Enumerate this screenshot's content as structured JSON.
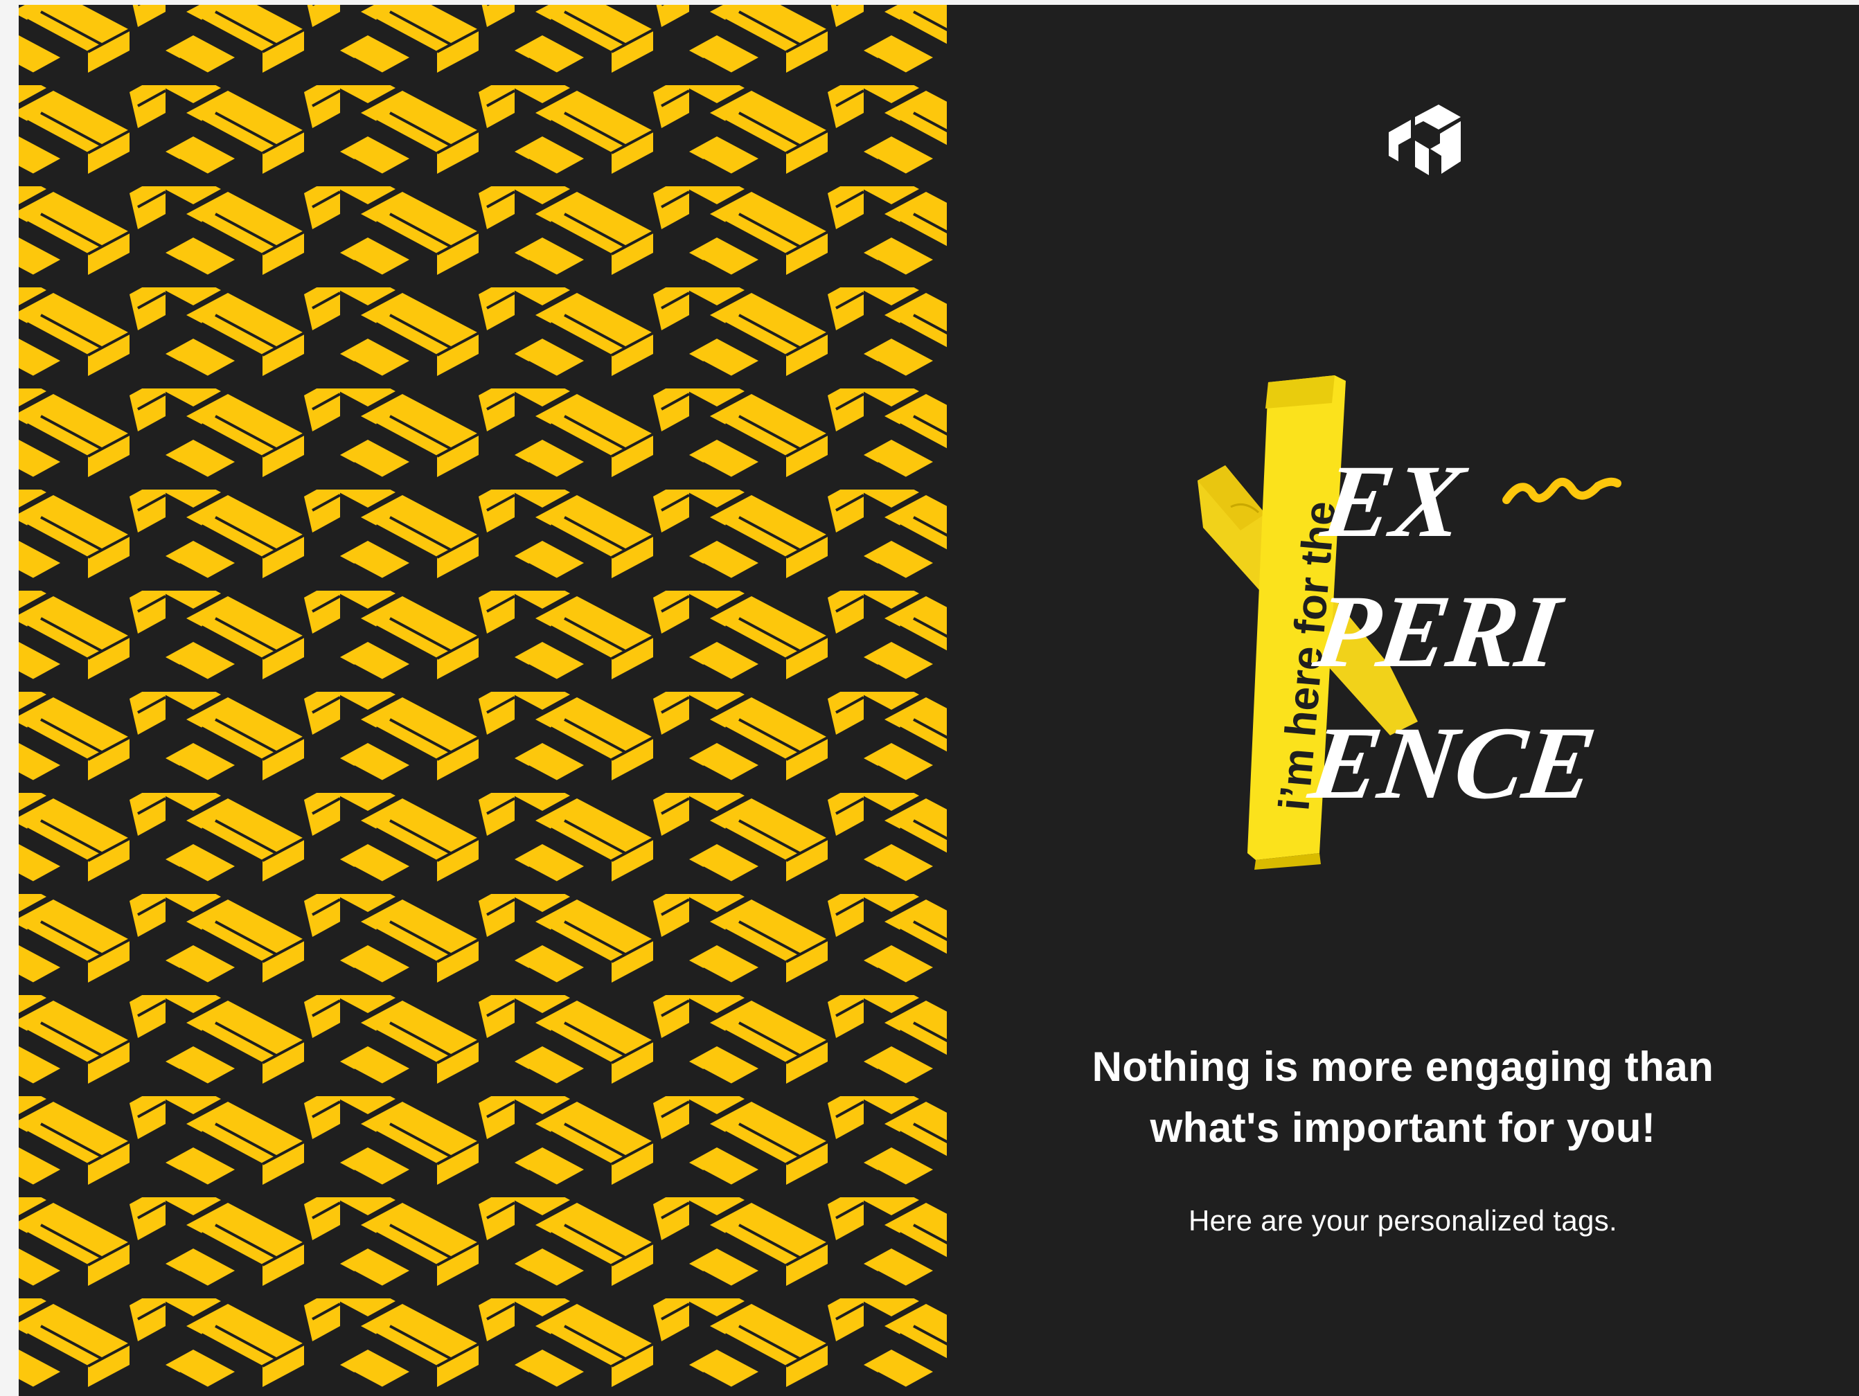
{
  "colors": {
    "background": "#1f1f1f",
    "accent_yellow": "#fdc70c",
    "text": "#ffffff"
  },
  "logo": {
    "icon": "brand-cube-logo-icon"
  },
  "hero": {
    "tape_text": "i’m here for the",
    "word_line_1": "EX",
    "word_line_2": "PERI",
    "word_line_3": "ENCE"
  },
  "headline": {
    "line_1": "Nothing is more engaging than",
    "line_2": "what's important for you!"
  },
  "subtext": "Here are your personalized tags."
}
